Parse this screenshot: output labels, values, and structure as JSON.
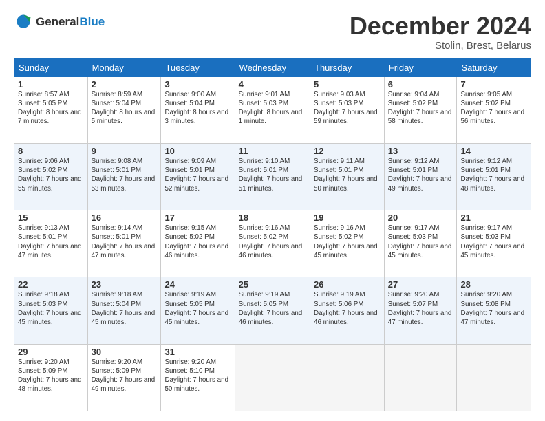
{
  "logo": {
    "line1": "General",
    "line2": "Blue"
  },
  "title": "December 2024",
  "subtitle": "Stolin, Brest, Belarus",
  "headers": [
    "Sunday",
    "Monday",
    "Tuesday",
    "Wednesday",
    "Thursday",
    "Friday",
    "Saturday"
  ],
  "weeks": [
    [
      {
        "day": "1",
        "sunrise": "Sunrise: 8:57 AM",
        "sunset": "Sunset: 5:05 PM",
        "daylight": "Daylight: 8 hours and 7 minutes."
      },
      {
        "day": "2",
        "sunrise": "Sunrise: 8:59 AM",
        "sunset": "Sunset: 5:04 PM",
        "daylight": "Daylight: 8 hours and 5 minutes."
      },
      {
        "day": "3",
        "sunrise": "Sunrise: 9:00 AM",
        "sunset": "Sunset: 5:04 PM",
        "daylight": "Daylight: 8 hours and 3 minutes."
      },
      {
        "day": "4",
        "sunrise": "Sunrise: 9:01 AM",
        "sunset": "Sunset: 5:03 PM",
        "daylight": "Daylight: 8 hours and 1 minute."
      },
      {
        "day": "5",
        "sunrise": "Sunrise: 9:03 AM",
        "sunset": "Sunset: 5:03 PM",
        "daylight": "Daylight: 7 hours and 59 minutes."
      },
      {
        "day": "6",
        "sunrise": "Sunrise: 9:04 AM",
        "sunset": "Sunset: 5:02 PM",
        "daylight": "Daylight: 7 hours and 58 minutes."
      },
      {
        "day": "7",
        "sunrise": "Sunrise: 9:05 AM",
        "sunset": "Sunset: 5:02 PM",
        "daylight": "Daylight: 7 hours and 56 minutes."
      }
    ],
    [
      {
        "day": "8",
        "sunrise": "Sunrise: 9:06 AM",
        "sunset": "Sunset: 5:02 PM",
        "daylight": "Daylight: 7 hours and 55 minutes."
      },
      {
        "day": "9",
        "sunrise": "Sunrise: 9:08 AM",
        "sunset": "Sunset: 5:01 PM",
        "daylight": "Daylight: 7 hours and 53 minutes."
      },
      {
        "day": "10",
        "sunrise": "Sunrise: 9:09 AM",
        "sunset": "Sunset: 5:01 PM",
        "daylight": "Daylight: 7 hours and 52 minutes."
      },
      {
        "day": "11",
        "sunrise": "Sunrise: 9:10 AM",
        "sunset": "Sunset: 5:01 PM",
        "daylight": "Daylight: 7 hours and 51 minutes."
      },
      {
        "day": "12",
        "sunrise": "Sunrise: 9:11 AM",
        "sunset": "Sunset: 5:01 PM",
        "daylight": "Daylight: 7 hours and 50 minutes."
      },
      {
        "day": "13",
        "sunrise": "Sunrise: 9:12 AM",
        "sunset": "Sunset: 5:01 PM",
        "daylight": "Daylight: 7 hours and 49 minutes."
      },
      {
        "day": "14",
        "sunrise": "Sunrise: 9:12 AM",
        "sunset": "Sunset: 5:01 PM",
        "daylight": "Daylight: 7 hours and 48 minutes."
      }
    ],
    [
      {
        "day": "15",
        "sunrise": "Sunrise: 9:13 AM",
        "sunset": "Sunset: 5:01 PM",
        "daylight": "Daylight: 7 hours and 47 minutes."
      },
      {
        "day": "16",
        "sunrise": "Sunrise: 9:14 AM",
        "sunset": "Sunset: 5:01 PM",
        "daylight": "Daylight: 7 hours and 47 minutes."
      },
      {
        "day": "17",
        "sunrise": "Sunrise: 9:15 AM",
        "sunset": "Sunset: 5:02 PM",
        "daylight": "Daylight: 7 hours and 46 minutes."
      },
      {
        "day": "18",
        "sunrise": "Sunrise: 9:16 AM",
        "sunset": "Sunset: 5:02 PM",
        "daylight": "Daylight: 7 hours and 46 minutes."
      },
      {
        "day": "19",
        "sunrise": "Sunrise: 9:16 AM",
        "sunset": "Sunset: 5:02 PM",
        "daylight": "Daylight: 7 hours and 45 minutes."
      },
      {
        "day": "20",
        "sunrise": "Sunrise: 9:17 AM",
        "sunset": "Sunset: 5:03 PM",
        "daylight": "Daylight: 7 hours and 45 minutes."
      },
      {
        "day": "21",
        "sunrise": "Sunrise: 9:17 AM",
        "sunset": "Sunset: 5:03 PM",
        "daylight": "Daylight: 7 hours and 45 minutes."
      }
    ],
    [
      {
        "day": "22",
        "sunrise": "Sunrise: 9:18 AM",
        "sunset": "Sunset: 5:03 PM",
        "daylight": "Daylight: 7 hours and 45 minutes."
      },
      {
        "day": "23",
        "sunrise": "Sunrise: 9:18 AM",
        "sunset": "Sunset: 5:04 PM",
        "daylight": "Daylight: 7 hours and 45 minutes."
      },
      {
        "day": "24",
        "sunrise": "Sunrise: 9:19 AM",
        "sunset": "Sunset: 5:05 PM",
        "daylight": "Daylight: 7 hours and 45 minutes."
      },
      {
        "day": "25",
        "sunrise": "Sunrise: 9:19 AM",
        "sunset": "Sunset: 5:05 PM",
        "daylight": "Daylight: 7 hours and 46 minutes."
      },
      {
        "day": "26",
        "sunrise": "Sunrise: 9:19 AM",
        "sunset": "Sunset: 5:06 PM",
        "daylight": "Daylight: 7 hours and 46 minutes."
      },
      {
        "day": "27",
        "sunrise": "Sunrise: 9:20 AM",
        "sunset": "Sunset: 5:07 PM",
        "daylight": "Daylight: 7 hours and 47 minutes."
      },
      {
        "day": "28",
        "sunrise": "Sunrise: 9:20 AM",
        "sunset": "Sunset: 5:08 PM",
        "daylight": "Daylight: 7 hours and 47 minutes."
      }
    ],
    [
      {
        "day": "29",
        "sunrise": "Sunrise: 9:20 AM",
        "sunset": "Sunset: 5:09 PM",
        "daylight": "Daylight: 7 hours and 48 minutes."
      },
      {
        "day": "30",
        "sunrise": "Sunrise: 9:20 AM",
        "sunset": "Sunset: 5:09 PM",
        "daylight": "Daylight: 7 hours and 49 minutes."
      },
      {
        "day": "31",
        "sunrise": "Sunrise: 9:20 AM",
        "sunset": "Sunset: 5:10 PM",
        "daylight": "Daylight: 7 hours and 50 minutes."
      },
      null,
      null,
      null,
      null
    ]
  ]
}
